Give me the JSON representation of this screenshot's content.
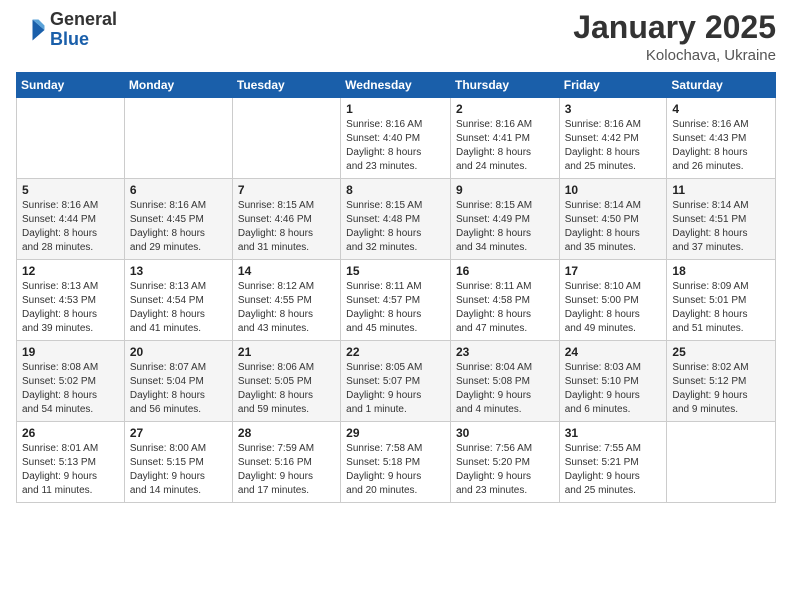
{
  "logo": {
    "general": "General",
    "blue": "Blue"
  },
  "title": "January 2025",
  "location": "Kolochava, Ukraine",
  "weekdays": [
    "Sunday",
    "Monday",
    "Tuesday",
    "Wednesday",
    "Thursday",
    "Friday",
    "Saturday"
  ],
  "weeks": [
    [
      {
        "day": "",
        "info": ""
      },
      {
        "day": "",
        "info": ""
      },
      {
        "day": "",
        "info": ""
      },
      {
        "day": "1",
        "info": "Sunrise: 8:16 AM\nSunset: 4:40 PM\nDaylight: 8 hours\nand 23 minutes."
      },
      {
        "day": "2",
        "info": "Sunrise: 8:16 AM\nSunset: 4:41 PM\nDaylight: 8 hours\nand 24 minutes."
      },
      {
        "day": "3",
        "info": "Sunrise: 8:16 AM\nSunset: 4:42 PM\nDaylight: 8 hours\nand 25 minutes."
      },
      {
        "day": "4",
        "info": "Sunrise: 8:16 AM\nSunset: 4:43 PM\nDaylight: 8 hours\nand 26 minutes."
      }
    ],
    [
      {
        "day": "5",
        "info": "Sunrise: 8:16 AM\nSunset: 4:44 PM\nDaylight: 8 hours\nand 28 minutes."
      },
      {
        "day": "6",
        "info": "Sunrise: 8:16 AM\nSunset: 4:45 PM\nDaylight: 8 hours\nand 29 minutes."
      },
      {
        "day": "7",
        "info": "Sunrise: 8:15 AM\nSunset: 4:46 PM\nDaylight: 8 hours\nand 31 minutes."
      },
      {
        "day": "8",
        "info": "Sunrise: 8:15 AM\nSunset: 4:48 PM\nDaylight: 8 hours\nand 32 minutes."
      },
      {
        "day": "9",
        "info": "Sunrise: 8:15 AM\nSunset: 4:49 PM\nDaylight: 8 hours\nand 34 minutes."
      },
      {
        "day": "10",
        "info": "Sunrise: 8:14 AM\nSunset: 4:50 PM\nDaylight: 8 hours\nand 35 minutes."
      },
      {
        "day": "11",
        "info": "Sunrise: 8:14 AM\nSunset: 4:51 PM\nDaylight: 8 hours\nand 37 minutes."
      }
    ],
    [
      {
        "day": "12",
        "info": "Sunrise: 8:13 AM\nSunset: 4:53 PM\nDaylight: 8 hours\nand 39 minutes."
      },
      {
        "day": "13",
        "info": "Sunrise: 8:13 AM\nSunset: 4:54 PM\nDaylight: 8 hours\nand 41 minutes."
      },
      {
        "day": "14",
        "info": "Sunrise: 8:12 AM\nSunset: 4:55 PM\nDaylight: 8 hours\nand 43 minutes."
      },
      {
        "day": "15",
        "info": "Sunrise: 8:11 AM\nSunset: 4:57 PM\nDaylight: 8 hours\nand 45 minutes."
      },
      {
        "day": "16",
        "info": "Sunrise: 8:11 AM\nSunset: 4:58 PM\nDaylight: 8 hours\nand 47 minutes."
      },
      {
        "day": "17",
        "info": "Sunrise: 8:10 AM\nSunset: 5:00 PM\nDaylight: 8 hours\nand 49 minutes."
      },
      {
        "day": "18",
        "info": "Sunrise: 8:09 AM\nSunset: 5:01 PM\nDaylight: 8 hours\nand 51 minutes."
      }
    ],
    [
      {
        "day": "19",
        "info": "Sunrise: 8:08 AM\nSunset: 5:02 PM\nDaylight: 8 hours\nand 54 minutes."
      },
      {
        "day": "20",
        "info": "Sunrise: 8:07 AM\nSunset: 5:04 PM\nDaylight: 8 hours\nand 56 minutes."
      },
      {
        "day": "21",
        "info": "Sunrise: 8:06 AM\nSunset: 5:05 PM\nDaylight: 8 hours\nand 59 minutes."
      },
      {
        "day": "22",
        "info": "Sunrise: 8:05 AM\nSunset: 5:07 PM\nDaylight: 9 hours\nand 1 minute."
      },
      {
        "day": "23",
        "info": "Sunrise: 8:04 AM\nSunset: 5:08 PM\nDaylight: 9 hours\nand 4 minutes."
      },
      {
        "day": "24",
        "info": "Sunrise: 8:03 AM\nSunset: 5:10 PM\nDaylight: 9 hours\nand 6 minutes."
      },
      {
        "day": "25",
        "info": "Sunrise: 8:02 AM\nSunset: 5:12 PM\nDaylight: 9 hours\nand 9 minutes."
      }
    ],
    [
      {
        "day": "26",
        "info": "Sunrise: 8:01 AM\nSunset: 5:13 PM\nDaylight: 9 hours\nand 11 minutes."
      },
      {
        "day": "27",
        "info": "Sunrise: 8:00 AM\nSunset: 5:15 PM\nDaylight: 9 hours\nand 14 minutes."
      },
      {
        "day": "28",
        "info": "Sunrise: 7:59 AM\nSunset: 5:16 PM\nDaylight: 9 hours\nand 17 minutes."
      },
      {
        "day": "29",
        "info": "Sunrise: 7:58 AM\nSunset: 5:18 PM\nDaylight: 9 hours\nand 20 minutes."
      },
      {
        "day": "30",
        "info": "Sunrise: 7:56 AM\nSunset: 5:20 PM\nDaylight: 9 hours\nand 23 minutes."
      },
      {
        "day": "31",
        "info": "Sunrise: 7:55 AM\nSunset: 5:21 PM\nDaylight: 9 hours\nand 25 minutes."
      },
      {
        "day": "",
        "info": ""
      }
    ]
  ]
}
